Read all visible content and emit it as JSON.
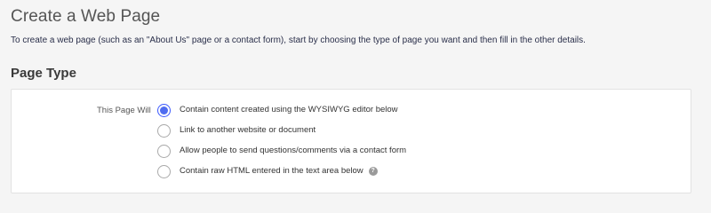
{
  "page": {
    "title": "Create a Web Page",
    "description": "To create a web page (such as an \"About Us\" page or a contact form), start by choosing the type of page you want and then fill in the other details."
  },
  "page_type": {
    "heading": "Page Type",
    "field_label": "This Page Will",
    "selected_index": 0,
    "options": [
      {
        "label": "Contain content created using the WYSIWYG editor below",
        "checked": true
      },
      {
        "label": "Link to another website or document",
        "checked": false
      },
      {
        "label": "Allow people to send questions/comments via a contact form",
        "checked": false
      },
      {
        "label": "Contain raw HTML entered in the text area below",
        "checked": false,
        "help_icon": "question-circle-icon"
      }
    ]
  },
  "colors": {
    "accent": "#4f6cf0",
    "background": "#f5f5f5",
    "panel": "#ffffff"
  }
}
